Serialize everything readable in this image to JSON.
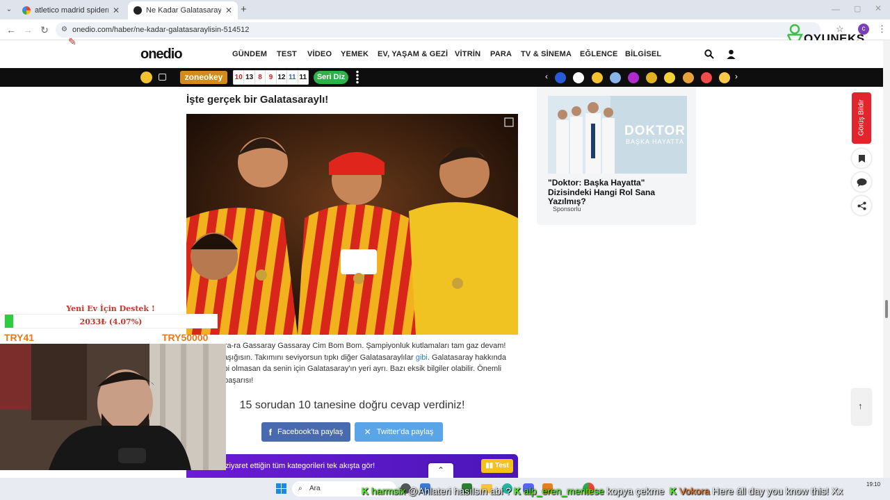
{
  "browser": {
    "tabs": [
      {
        "title": "atletico madrid spiderman form",
        "active": false
      },
      {
        "title": "Ne Kadar Galatasaraylısın? - On",
        "active": true
      }
    ],
    "url": "onedio.com/haber/ne-kadar-galatasaraylisin-514512",
    "new_tab_symbol": "+",
    "profile_initial": "c"
  },
  "site": {
    "logo": "onedio",
    "nav": [
      "GÜNDEM",
      "TEST",
      "VİDEO",
      "YEMEK",
      "EV, YAŞAM & GEZİ",
      "VİTRİN",
      "PARA",
      "TV & SİNEMA",
      "EĞLENCE",
      "BİLGİSEL"
    ],
    "zone_label": "zoneokey",
    "game_numbers": [
      "10",
      "13",
      "8",
      "9",
      "12",
      "11",
      "11"
    ],
    "seri_diz": "Seri Diz"
  },
  "article": {
    "heading": "İşte gerçek bir Galatasaraylı!",
    "text_parts": [
      "a-ra-ra Gassaray Gassaray Cim Bom Bom. Şampiyonluk kutlamaları tam gaz devam!",
      "y aşığısın. Takımını seviyorsun tıpkı diğer Galatasaraylılar",
      "gibi",
      ". Galatasaray hakkında",
      "hibi olmasan da senin için Galatasaray'ın yeri ayrı. Bazı eksik bilgiler olabilir. Önemli",
      "n başarısı!"
    ],
    "result": "15 sorudan 10 tanesine doğru cevap verdiniz!",
    "share_facebook": "Facebook'ta paylaş",
    "share_twitter": "Twitter'da paylaş",
    "promo": "ziyaret ettiğin tüm kategorileri tek akışta gör!",
    "promo_badge": "Test"
  },
  "sidebar": {
    "poster_title": "DOKTOR",
    "poster_subtitle": "BAŞKA HAYATTA",
    "title": "\"Doktor: Başka Hayatta\" Dizisindeki Hangi Rol Sana Yazılmış?",
    "sponsor": "Sponsorlu"
  },
  "floating": {
    "feedback": "Görüş Bildir"
  },
  "overlay": {
    "brand": "OYUNEKS",
    "donation_title": "Yeni Ev İçin Destek !",
    "donation_amount": "2033₺ (4.07%)",
    "donation_progress": 0.0407,
    "donation_min": "TRY41",
    "donation_max": "TRY50000"
  },
  "chat": [
    {
      "user": "harmsix",
      "message": "@Ahlateri hasılsın abi ?"
    },
    {
      "user": "alp_eren_mentese",
      "message": "kopya çekme"
    },
    {
      "user": "Vokora",
      "message": "Here áll day you know this! Xx"
    }
  ],
  "taskbar": {
    "search_placeholder": "Ara",
    "time": "19:10"
  },
  "colors": {
    "accent_red": "#e2252d",
    "facebook": "#4a6ab0",
    "twitter": "#5aa4e8",
    "kick_green": "#53fc18",
    "promo_purple": "#6d1bd6"
  }
}
